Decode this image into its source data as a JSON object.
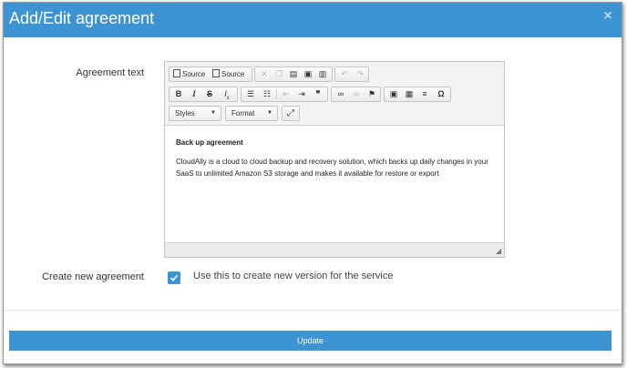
{
  "dialog": {
    "title": "Add/Edit agreement",
    "close_glyph": "×"
  },
  "form": {
    "agreement_label": "Agreement text",
    "create_label": "Create new agreement",
    "checkbox_text": "Use this to create new version for the service",
    "checkbox_checked": true
  },
  "toolbar": {
    "source_1": "Source",
    "source_2": "Source",
    "styles_combo": "Styles",
    "format_combo": "Format",
    "icons_row1": [
      "source-icon",
      "source-icon",
      "cut-icon",
      "copy-icon",
      "paste-icon",
      "paste-text-icon",
      "paste-word-icon",
      "undo-icon",
      "redo-icon"
    ],
    "icons_row2": [
      "bold-icon",
      "italic-icon",
      "strike-icon",
      "remove-format-icon",
      "numbered-list-icon",
      "bulleted-list-icon",
      "outdent-icon",
      "indent-icon",
      "blockquote-icon",
      "link-icon",
      "unlink-icon",
      "anchor-icon",
      "image-icon",
      "table-icon",
      "horizontal-rule-icon",
      "special-char-icon"
    ],
    "icons_row3": [
      "maximize-icon"
    ]
  },
  "content": {
    "heading": "Back up agreement",
    "body": "CloudAlly is a cloud to cloud backup and recovery solution, which backs up daily changes in your SaaS to unlimited Amazon S3 storage and makes it available for restore or export"
  },
  "actions": {
    "update_label": "Update"
  },
  "colors": {
    "accent": "#3c94d2",
    "header_text": "#ffffff"
  }
}
